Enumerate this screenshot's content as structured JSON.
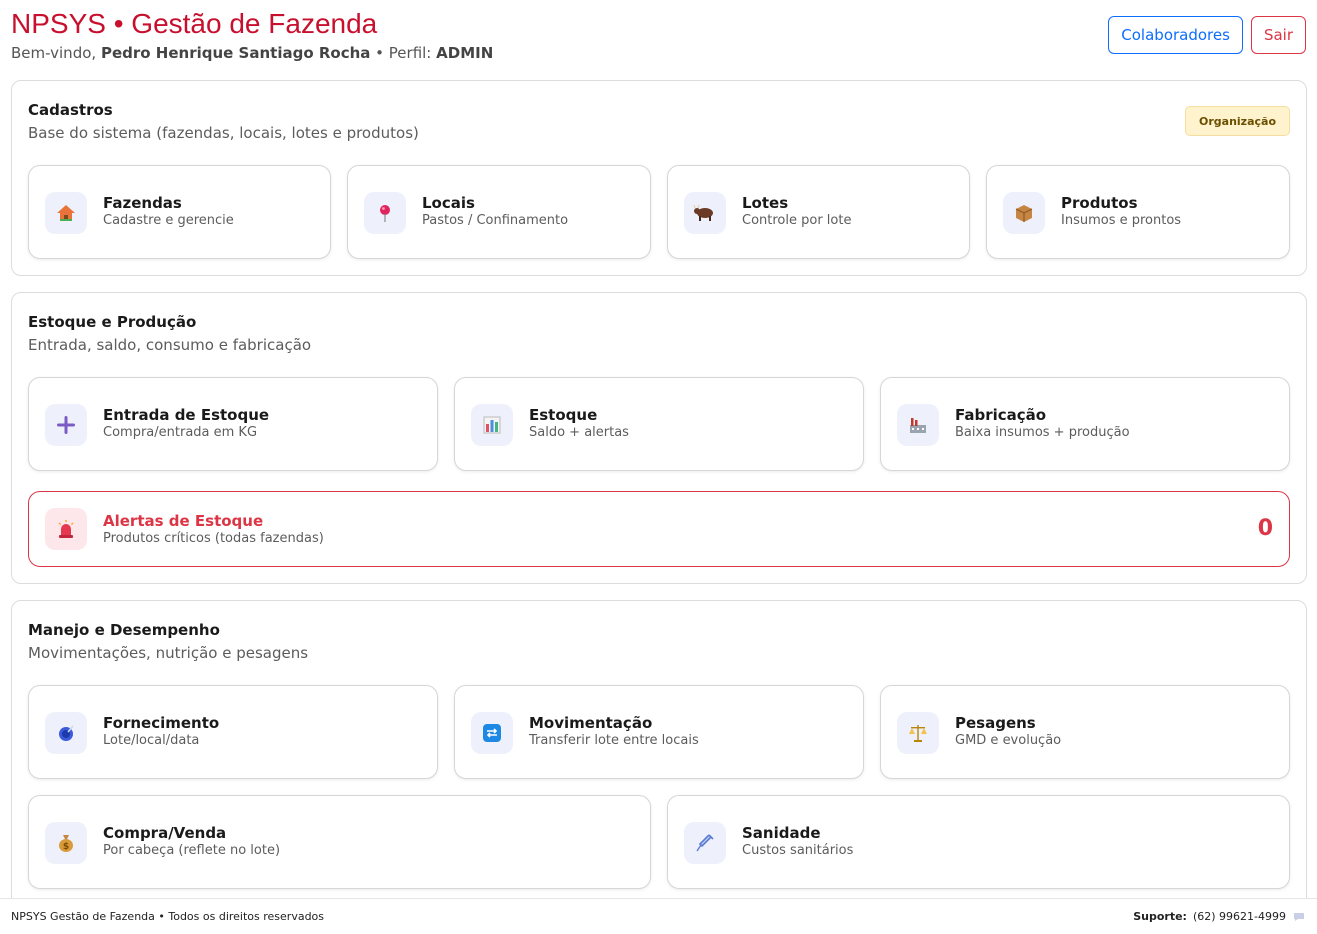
{
  "header": {
    "title": "NPSYS • Gestão de Fazenda",
    "welcome_prefix": "Bem-vindo,",
    "user_name": "Pedro Henrique Santiago Rocha",
    "profile_prefix": "• Perfil:",
    "profile": "ADMIN",
    "btn_colaboradores": "Colaboradores",
    "btn_sair": "Sair"
  },
  "cadastros": {
    "title": "Cadastros",
    "subtitle": "Base do sistema (fazendas, locais, lotes e produtos)",
    "badge": "Organização",
    "cards": [
      {
        "title": "Fazendas",
        "desc": "Cadastre e gerencie",
        "icon": "house-icon"
      },
      {
        "title": "Locais",
        "desc": "Pastos / Confinamento",
        "icon": "pin-icon"
      },
      {
        "title": "Lotes",
        "desc": "Controle por lote",
        "icon": "ox-icon"
      },
      {
        "title": "Produtos",
        "desc": "Insumos e prontos",
        "icon": "package-icon"
      }
    ]
  },
  "estoque": {
    "title": "Estoque e Produção",
    "subtitle": "Entrada, saldo, consumo e fabricação",
    "cards": [
      {
        "title": "Entrada de Estoque",
        "desc": "Compra/entrada em KG",
        "icon": "plus-icon"
      },
      {
        "title": "Estoque",
        "desc": "Saldo + alertas",
        "icon": "bar-chart-icon"
      },
      {
        "title": "Fabricação",
        "desc": "Baixa insumos + produção",
        "icon": "factory-icon"
      }
    ],
    "alert": {
      "title": "Alertas de Estoque",
      "desc": "Produtos críticos (todas fazendas)",
      "count": "0",
      "icon": "siren-icon"
    }
  },
  "manejo": {
    "title": "Manejo e Desempenho",
    "subtitle": "Movimentações, nutrição e pesagens",
    "cards": [
      {
        "title": "Fornecimento",
        "desc": "Lote/local/data",
        "icon": "bowl-icon"
      },
      {
        "title": "Movimentação",
        "desc": "Transferir lote entre locais",
        "icon": "transfer-icon"
      },
      {
        "title": "Pesagens",
        "desc": "GMD e evolução",
        "icon": "scale-icon"
      },
      {
        "title": "Compra/Venda",
        "desc": "Por cabeça (reflete no lote)",
        "icon": "money-bag-icon"
      },
      {
        "title": "Sanidade",
        "desc": "Custos sanitários",
        "icon": "syringe-icon"
      }
    ]
  },
  "footer": {
    "left": "NPSYS Gestão de Fazenda • Todos os direitos reservados",
    "support_label": "Suporte:",
    "support_phone": "(62) 99621-4999"
  },
  "colors": {
    "brand": "#c8102e",
    "primary": "#0d6efd",
    "danger": "#dc3545",
    "badge_bg": "#fff3cd"
  }
}
